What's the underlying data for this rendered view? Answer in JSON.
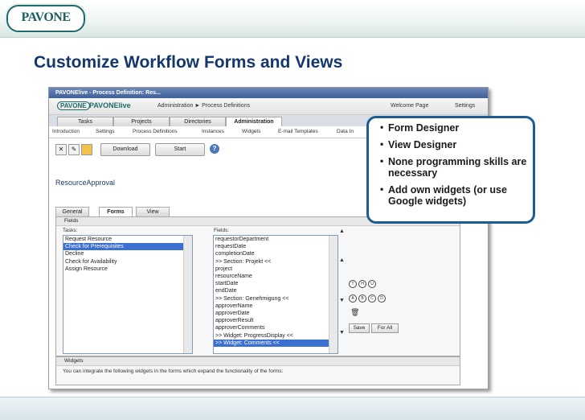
{
  "slide": {
    "logo_text": "PAVONE",
    "title": "Customize Workflow Forms and Views",
    "bullets": [
      "Form Designer",
      "View Designer",
      "None programming skills are necessary",
      "Add own widgets (or use Google widgets)"
    ]
  },
  "app": {
    "window_title": "PAVONElive - Process Definition: Res...",
    "logo_text": "PAVONE",
    "brand": "PAVONElive",
    "breadcrumb": "Administration ► Process Definitions",
    "welcome_label": "Welcome Page",
    "settings_label": "Settings",
    "tabs": [
      "Tasks",
      "Projects",
      "Directories",
      "Administration"
    ],
    "subnav": [
      "Introduction",
      "Settings",
      "Process Definitions",
      "Instances",
      "Widgets",
      "E-mail Templates",
      "Data In"
    ],
    "toolbar": {
      "download_label": "Download",
      "start_label": "Start",
      "help_label": "?"
    },
    "document_name": "ResourceApproval",
    "form_tabs": [
      "General",
      "Forms",
      "View"
    ],
    "fields_section": "Fields",
    "tasks_label": "Tasks:",
    "fields_label": "Fields:",
    "tasks": [
      "Request Resource",
      "Check for Prerequisites",
      "Decline",
      "Check for Availability",
      "Assign Resource"
    ],
    "selected_task": 1,
    "fields": [
      "requestorDepartment",
      "requestDate",
      "completionDate",
      ">> Section: Projekt <<",
      "project",
      "resourceName",
      "startDate",
      "endDate",
      ">> Section: Genehmigung <<",
      "approverName",
      "approverDate",
      "approverResult",
      "approverComments",
      ">> Widget: ProgressDisplay <<",
      ">> Widget: Comments <<"
    ],
    "selected_field": 14,
    "save_label": "Save",
    "for_all_label": "For All",
    "widgets_section": "Widgets",
    "widgets_text": "You can integrate the following widgets in the forms which expand the functionality of the forms:"
  }
}
